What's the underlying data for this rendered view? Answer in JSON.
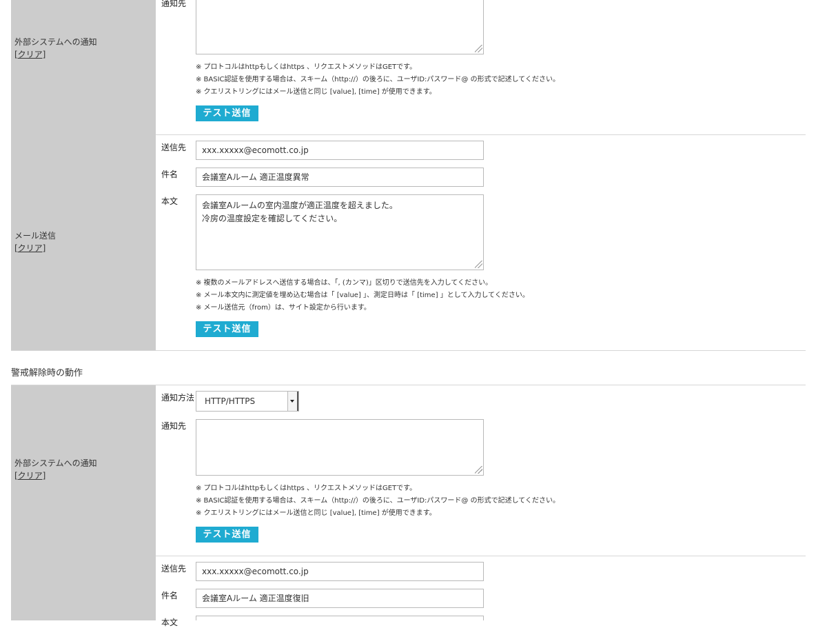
{
  "trigger": {
    "external": {
      "label": "外部システムへの通知",
      "clear": "[クリア]",
      "destination_label": "通知先",
      "destination_value": "",
      "notes": [
        "※ プロトコルはhttpもしくはhttps 、リクエストメソッドはGETです。",
        "※ BASIC認証を使用する場合は、スキーム（http://）の後ろに、ユーザID:パスワード@ の形式で記述してください。",
        "※ クエリストリングにはメール送信と同じ [value], [time] が使用できます。"
      ],
      "test_button": "テスト送信"
    },
    "mail": {
      "label": "メール送信",
      "clear": "[クリア]",
      "to_label": "送信先",
      "to_value": "xxx.xxxxx@ecomott.co.jp",
      "subject_label": "件名",
      "subject_value": "会議室Aルーム 適正温度異常",
      "body_label": "本文",
      "body_value": "会議室Aルームの室内温度が適正温度を超えました。\n冷房の温度設定を確認してください。",
      "notes": [
        "※ 複数のメールアドレスへ送信する場合は、「, (カンマ)」区切りで送信先を入力してください。",
        "※ メール本文内に測定値を埋め込む場合は「 [value] 」、測定日時は「 [time] 」として入力してください。",
        "※ メール送信元（from）は、サイト設定から行います。"
      ],
      "test_button": "テスト送信"
    }
  },
  "release": {
    "section_title": "警戒解除時の動作",
    "external": {
      "label": "外部システムへの通知",
      "clear": "[クリア]",
      "method_label": "通知方法",
      "method_value": "HTTP/HTTPS",
      "destination_label": "通知先",
      "destination_value": "",
      "notes": [
        "※ プロトコルはhttpもしくはhttps 、リクエストメソッドはGETです。",
        "※ BASIC認証を使用する場合は、スキーム（http://）の後ろに、ユーザID:パスワード@ の形式で記述してください。",
        "※ クエリストリングにはメール送信と同じ [value], [time] が使用できます。"
      ],
      "test_button": "テスト送信"
    },
    "mail": {
      "to_label": "送信先",
      "to_value": "xxx.xxxxx@ecomott.co.jp",
      "subject_label": "件名",
      "subject_value": "会議室Aルーム 適正温度復旧",
      "body_label": "本文"
    }
  },
  "colors": {
    "label_bg": "#cccccc",
    "button_bg": "#1fabd1",
    "divider": "#d6d6d6"
  }
}
